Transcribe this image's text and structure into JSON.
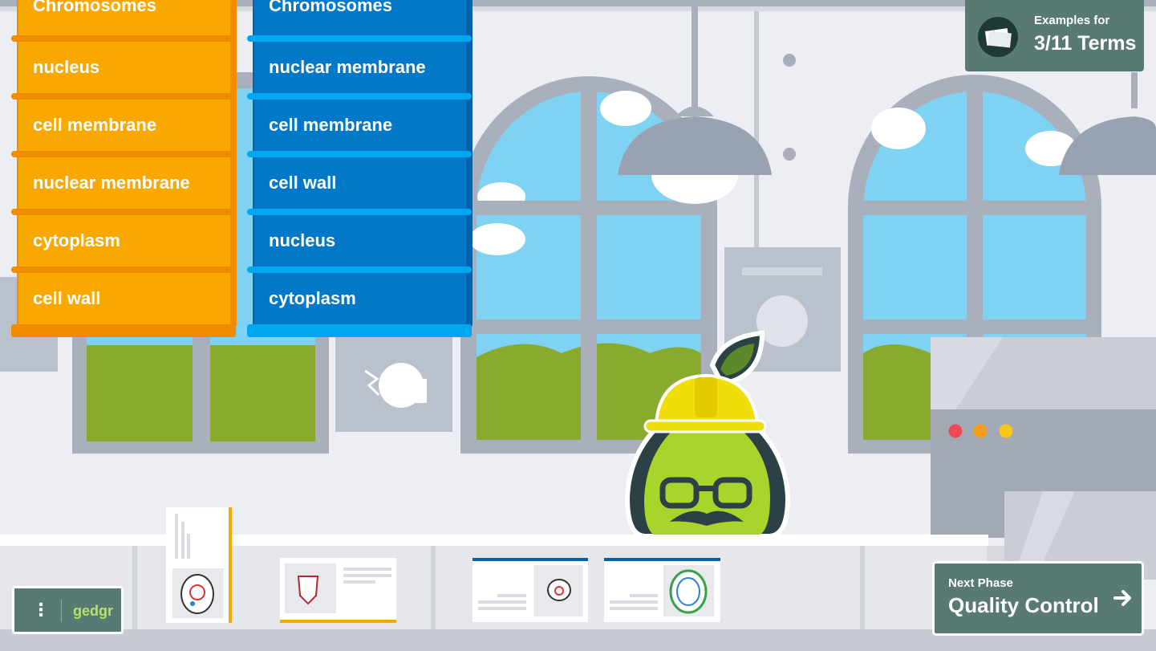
{
  "left_column": {
    "title": "Chromosomes",
    "items": [
      "nucleus",
      "cell membrane",
      "nuclear membrane",
      "cytoplasm",
      "cell wall"
    ]
  },
  "right_column": {
    "title": "Chromosomes",
    "items": [
      "nuclear membrane",
      "cell membrane",
      "cell wall",
      "nucleus",
      "cytoplasm"
    ]
  },
  "examples": {
    "label": "Examples for",
    "count": "3/11 Terms"
  },
  "user_menu": {
    "menu_icon": "⋮",
    "username": "gedgr"
  },
  "next_phase": {
    "label": "Next Phase",
    "title": "Quality Control"
  },
  "machine_lights": [
    "#ef4b57",
    "#f59d1a",
    "#f7c71a"
  ],
  "colors": {
    "orange": "#f9a800",
    "blue": "#0279c8",
    "panel": "#587a72",
    "pear": "#a9d42c",
    "helmet": "#f0dd0a"
  }
}
